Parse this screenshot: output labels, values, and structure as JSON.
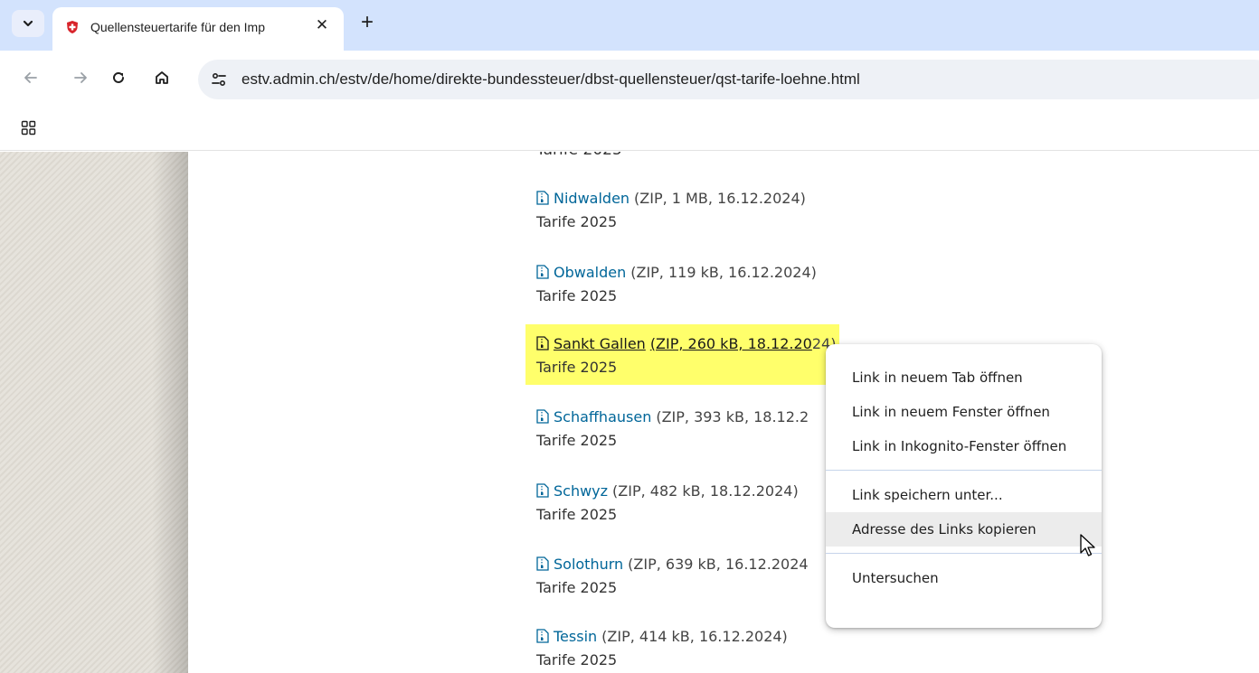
{
  "browser": {
    "tab": {
      "title": "Quellensteuertarife für den Imp",
      "close_glyph": "✕",
      "favicon": "swiss-shield-icon"
    },
    "new_tab_glyph": "+",
    "url": "estv.admin.ch/estv/de/home/direkte-bundessteuer/dbst-quellensteuer/qst-tarife-loehne.html"
  },
  "page": {
    "clipped_text": "Tarife 2025",
    "items": [
      {
        "name": "Nidwalden",
        "meta": "(ZIP, 1 MB, 16.12.2024)",
        "sub": "Tarife 2025"
      },
      {
        "name": "Obwalden",
        "meta": "(ZIP, 119 kB, 16.12.2024)",
        "sub": "Tarife 2025"
      },
      {
        "name": "Sankt Gallen",
        "meta": "(ZIP, 260 kB, 18.12.20",
        "meta_tail": "24)",
        "sub": "Tarife 2025"
      },
      {
        "name": "Schaffhausen",
        "meta": "(ZIP, 393 kB, 18.12.2",
        "sub": "Tarife 2025"
      },
      {
        "name": "Schwyz",
        "meta": "(ZIP, 482 kB, 18.12.2024)",
        "sub": "Tarife 2025"
      },
      {
        "name": "Solothurn",
        "meta": "(ZIP, 639 kB, 16.12.2024",
        "sub": "Tarife 2025"
      },
      {
        "name": "Tessin",
        "meta": "(ZIP, 414 kB, 16.12.2024)",
        "sub": "Tarife 2025"
      }
    ]
  },
  "context_menu": {
    "open_new_tab": "Link in neuem Tab öffnen",
    "open_new_window": "Link in neuem Fenster öffnen",
    "open_incognito": "Link in Inkognito-Fenster öffnen",
    "save_link_as": "Link speichern unter...",
    "copy_link_address": "Adresse des Links kopieren",
    "inspect": "Untersuchen"
  },
  "colors": {
    "link": "#006699",
    "highlight": "#ffff6b",
    "tabstrip": "#d3e3fd"
  }
}
